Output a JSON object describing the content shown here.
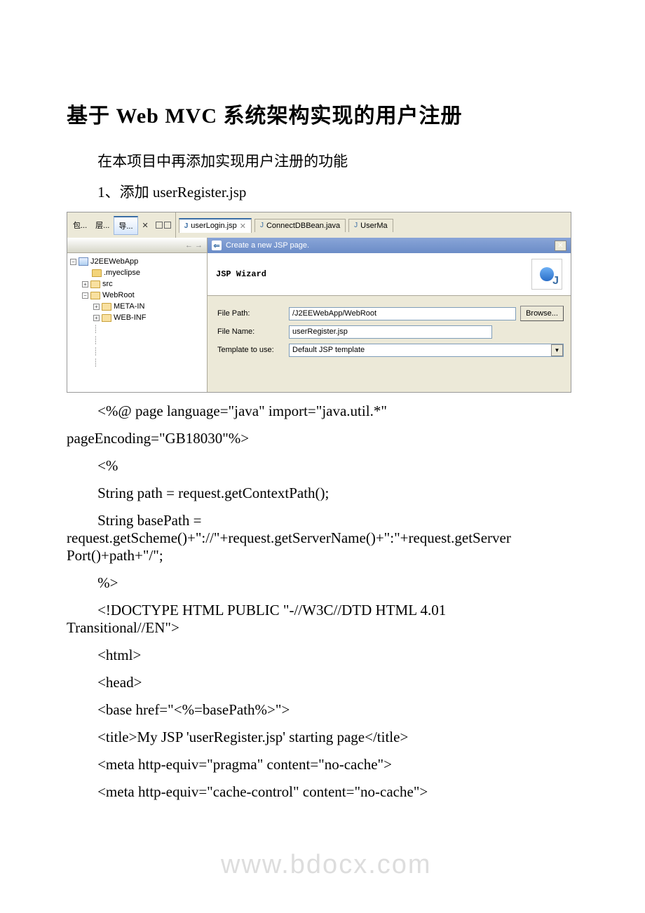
{
  "doc": {
    "title": "基于 Web MVC 系统架构实现的用户注册",
    "p1": "在本项目中再添加实现用户注册的功能",
    "p2": "1、添加 userRegister.jsp",
    "watermark": "www.bdocx.com"
  },
  "ide": {
    "views": {
      "pkg": "包...",
      "layer": "层...",
      "nav": "导..."
    },
    "tabs": {
      "active": "userLogin.jsp",
      "t2": "ConnectDBBean.java",
      "t3": "UserMa"
    },
    "navarrows": "←  →",
    "tree": {
      "root": "J2EEWebApp",
      "n1": ".myeclipse",
      "n2": "src",
      "n3": "WebRoot",
      "n31": "META-IN",
      "n32": "WEB-INF"
    },
    "wizard": {
      "title": "Create a new JSP page.",
      "heading": "JSP Wizard",
      "filepath_label": "File Path:",
      "filepath_value": "/J2EEWebApp/WebRoot",
      "filename_label": "File Name:",
      "filename_value": "userRegister.jsp",
      "template_label": "Template to use:",
      "template_value": "Default JSP template",
      "browse": "Browse..."
    }
  },
  "code": {
    "l1a": "<%@ page language=\"java\" import=\"java.util.*\"",
    "l1b": "pageEncoding=\"GB18030\"%>",
    "l2": "<%",
    "l3": "String path = request.getContextPath();",
    "l4": "String basePath =",
    "l4b": "request.getScheme()+\"://\"+request.getServerName()+\":\"+request.getServer",
    "l4c": "Port()+path+\"/\";",
    "l5": "%>",
    "l6": "<!DOCTYPE HTML PUBLIC \"-//W3C//DTD HTML 4.01",
    "l6b": "Transitional//EN\">",
    "l7": "<html>",
    "l8": " <head>",
    "l9": " <base href=\"<%=basePath%>\">",
    "l10": " <title>My JSP 'userRegister.jsp' starting page</title>",
    "l11": " <meta http-equiv=\"pragma\" content=\"no-cache\">",
    "l12": " <meta http-equiv=\"cache-control\" content=\"no-cache\">"
  }
}
